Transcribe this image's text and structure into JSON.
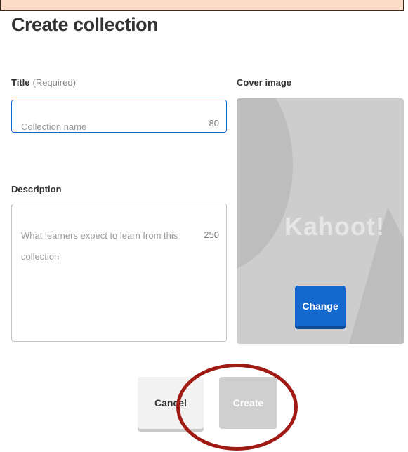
{
  "header": {
    "title": "Create collection"
  },
  "form": {
    "title_label": "Title",
    "title_required": "(Required)",
    "title_placeholder": "Collection name",
    "title_counter": "80",
    "description_label": "Description",
    "description_placeholder": "What learners expect to learn from this collection",
    "description_counter": "250",
    "cover_label": "Cover image",
    "cover_logo": "Kahoot!",
    "change_label": "Change"
  },
  "actions": {
    "cancel_label": "Cancel",
    "create_label": "Create"
  },
  "colors": {
    "accent": "#1368ce",
    "annotation": "#a01a14",
    "disabled": "#cfcfcf"
  }
}
